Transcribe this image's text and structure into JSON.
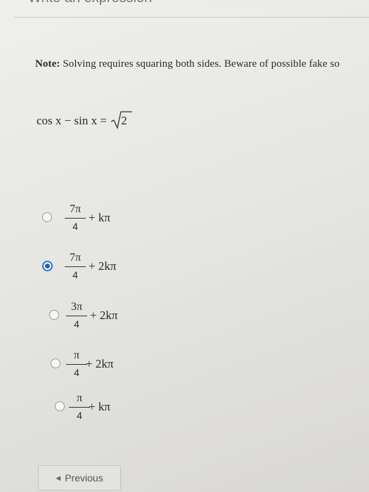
{
  "header": {
    "instruction_cut": "Write an expression"
  },
  "note": {
    "label": "Note:",
    "text": "Solving requires squaring both sides. Beware of possible fake so"
  },
  "equation": {
    "lhs": "cos x − sin x = ",
    "radicand": "2"
  },
  "options": [
    {
      "num": "7π",
      "den": "4",
      "rest": "+ kπ",
      "selected": false
    },
    {
      "num": "7π",
      "den": "4",
      "rest": "+ 2kπ",
      "selected": true
    },
    {
      "num": "3π",
      "den": "4",
      "rest": "+ 2kπ",
      "selected": false
    },
    {
      "num": "π",
      "den": "4",
      "rest": "+ 2kπ",
      "selected": false
    },
    {
      "num": "π",
      "den": "4",
      "rest": "+ kπ",
      "selected": false
    }
  ],
  "nav": {
    "previous_label": "Previous"
  },
  "colors": {
    "radio_selected": "#1c5fd4",
    "background": "#e9e9e6"
  }
}
